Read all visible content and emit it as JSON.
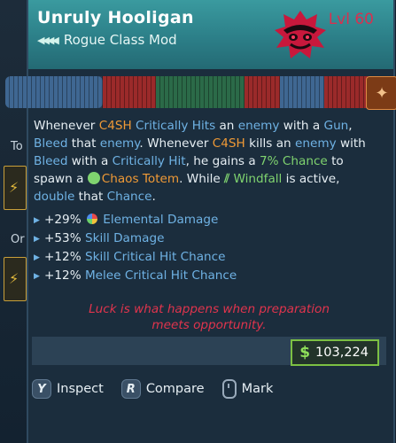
{
  "item": {
    "name": "Unruly Hooligan",
    "type": "Rogue Class Mod",
    "level": "Lvl 60"
  },
  "description": {
    "t1": "Whenever ",
    "c4sh1": "C4SH",
    "t2": " ",
    "crit_hits": "Critically Hits",
    "t3": " an ",
    "enemy1": "enemy",
    "t4": " with a ",
    "gun": "Gun",
    "t5": ", ",
    "bleed1": "Bleed",
    "t6": " that ",
    "enemy2": "enemy",
    "t7": ". Whenever ",
    "c4sh2": "C4SH",
    "t8": " kills an ",
    "enemy3": "enemy",
    "t9": " with ",
    "bleed2": "Bleed",
    "t10": " with a ",
    "crit_hit": "Critically Hit",
    "t11": ", he gains a ",
    "chance_pct": "7% Chance",
    "t12": " to spawn a ",
    "totem": "Chaos Totem",
    "t13": ". While ",
    "windfall": "Windfall",
    "t14": " is active, ",
    "double": "double",
    "t15": " that ",
    "chance": "Chance",
    "t16": "."
  },
  "stats": [
    {
      "value": "+29%",
      "name": "Elemental Damage"
    },
    {
      "value": "+53%",
      "name": "Skill Damage"
    },
    {
      "value": "+12%",
      "name": "Skill Critical Hit Chance"
    },
    {
      "value": "+12%",
      "name": "Melee Critical Hit Chance"
    }
  ],
  "flavor": {
    "line1": "Luck is what happens when preparation",
    "line2": "meets opportunity."
  },
  "price": {
    "symbol": "$",
    "amount": "103,224"
  },
  "actions": {
    "inspect_key": "Y",
    "inspect_label": "Inspect",
    "compare_key": "R",
    "compare_label": "Compare",
    "mark_label": "Mark"
  },
  "background": {
    "text_a": "To",
    "text_b": "Or"
  },
  "colors": {
    "header_teal": "#2c7f88",
    "level_red": "#d9304f",
    "keyword_orange": "#f09a36",
    "keyword_blue": "#6fb2e4",
    "keyword_green": "#7fd36f",
    "price_green": "#7cc043"
  },
  "icons": {
    "emblem": "hooligan-mask-emblem-icon",
    "chevrons": "class-mod-chevrons-icon",
    "bar_button": "fire-spark-icon",
    "mouse": "mouse-icon"
  }
}
